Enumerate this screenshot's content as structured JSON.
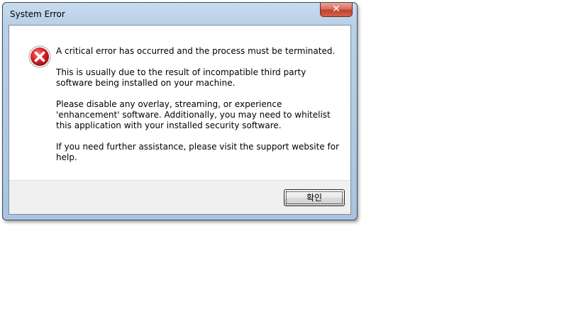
{
  "window": {
    "title": "System Error",
    "close_icon": "close-icon"
  },
  "dialog": {
    "icon": "error-icon",
    "paragraphs": [
      "A critical error has occurred and the process must be terminated.",
      "This is usually due to the result of incompatible third party software being installed on your machine.",
      "Please disable any overlay, streaming, or experience 'enhancement' software. Additionally, you may need to whitelist this application with your installed security software.",
      "If you need further assistance, please visit the support website for help."
    ],
    "ok_label": "확인"
  },
  "colors": {
    "error_red": "#d9262b",
    "close_red": "#c2422c",
    "frame_blue": "#b9d0e8"
  }
}
